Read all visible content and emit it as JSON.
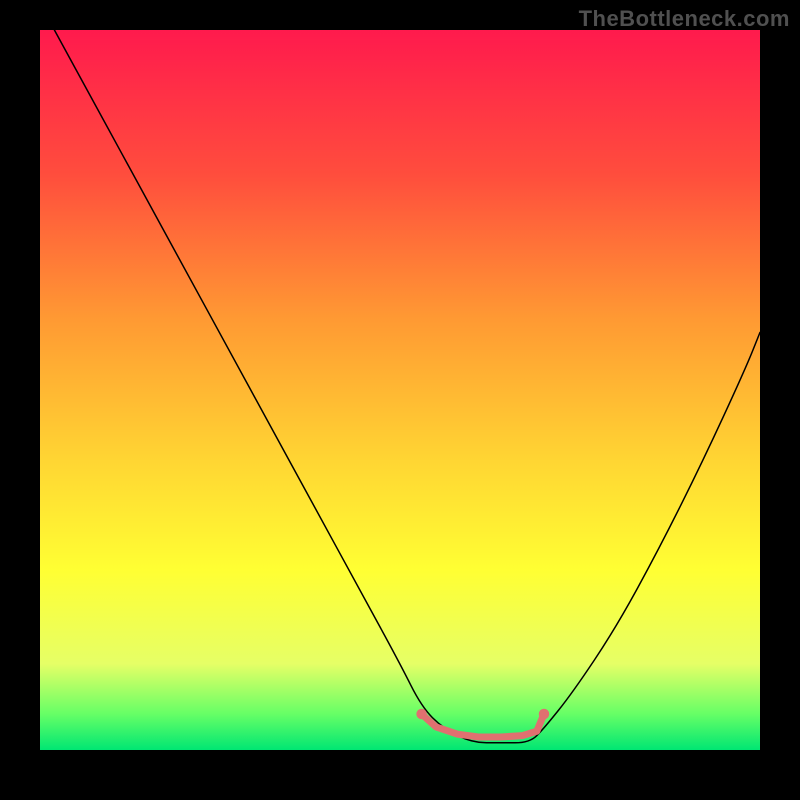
{
  "watermark": "TheBottleneck.com",
  "chart_data": {
    "type": "line",
    "title": "",
    "xlabel": "",
    "ylabel": "",
    "xlim": [
      0,
      100
    ],
    "ylim": [
      0,
      100
    ],
    "grid": false,
    "legend": false,
    "background_gradient": {
      "stops": [
        {
          "offset": 0.0,
          "color": "#ff1a4d"
        },
        {
          "offset": 0.2,
          "color": "#ff4d3d"
        },
        {
          "offset": 0.4,
          "color": "#ff9933"
        },
        {
          "offset": 0.6,
          "color": "#ffd633"
        },
        {
          "offset": 0.75,
          "color": "#ffff33"
        },
        {
          "offset": 0.88,
          "color": "#e6ff66"
        },
        {
          "offset": 0.95,
          "color": "#66ff66"
        },
        {
          "offset": 1.0,
          "color": "#00e673"
        }
      ]
    },
    "series": [
      {
        "name": "bottleneck-curve",
        "color": "#000000",
        "width": 1.5,
        "x": [
          2,
          8,
          14,
          20,
          26,
          32,
          38,
          44,
          50,
          53,
          56,
          60,
          64,
          68,
          70,
          74,
          80,
          86,
          92,
          98,
          100
        ],
        "y": [
          100,
          89,
          78,
          67,
          56,
          45,
          34,
          23,
          12,
          6,
          3,
          1,
          1,
          1,
          3,
          8,
          17,
          28,
          40,
          53,
          58
        ]
      },
      {
        "name": "fit-marker",
        "color": "#e07070",
        "width": 7,
        "x": [
          53,
          55,
          58,
          61,
          64,
          67,
          69,
          70
        ],
        "y": [
          5,
          3.2,
          2.2,
          1.8,
          1.8,
          2.0,
          2.6,
          5
        ]
      }
    ],
    "annotations": []
  }
}
